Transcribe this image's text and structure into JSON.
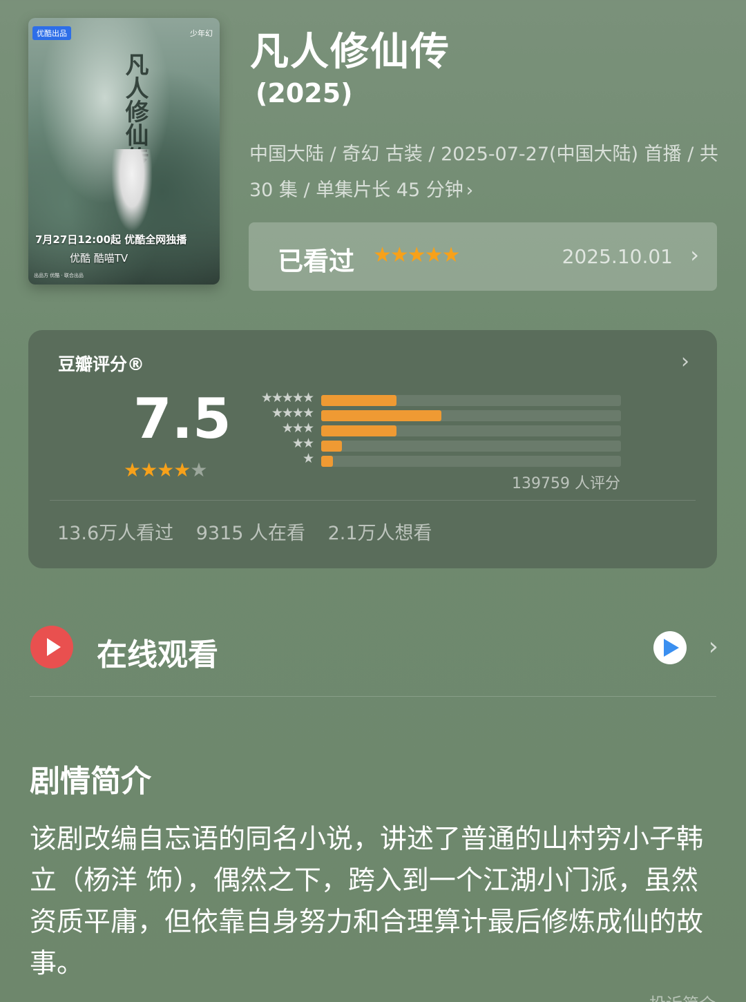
{
  "poster": {
    "tag": "优酷出品",
    "brand": "少年幻",
    "calligraphy": "凡人修仙传",
    "line1": "7月27日12:00起 优酷全网独播",
    "line2": "优酷  酷喵TV",
    "line3": "出品方 优酷 · 联合出品"
  },
  "title": "凡人修仙传",
  "year": "(2025)",
  "meta": "中国大陆 / 奇幻 古装 / 2025-07-27(中国大陆) 首播 / 共 30 集 / 单集片长 45 分钟",
  "watched": {
    "label": "已看过",
    "stars": "★★★★★",
    "date": "2025.10.01",
    "chevron": "›"
  },
  "rating": {
    "label": "豆瓣评分®",
    "score": "7.5",
    "stars_on": "★★★★",
    "stars_off": "★",
    "count": "139759 人评分",
    "rows": [
      {
        "label": "★★★★★",
        "fraction": 0.25
      },
      {
        "label": "★★★★",
        "fraction": 0.4
      },
      {
        "label": "★★★",
        "fraction": 0.25
      },
      {
        "label": "★★",
        "fraction": 0.07
      },
      {
        "label": "★",
        "fraction": 0.04
      }
    ],
    "stats": [
      "13.6万人看过",
      "9315 人在看",
      "2.1万人想看"
    ]
  },
  "online": {
    "label": "在线观看",
    "chevron": "›"
  },
  "synopsis": {
    "title": "剧情简介",
    "text": "该剧改编自忘语的同名小说，讲述了普通的山村穷小子韩立（杨洋 饰），偶然之下，跨入到一个江湖小门派，虽然资质平庸，但依靠自身努力和合理算计最后修炼成仙的故事。"
  },
  "report": "投诉简介"
}
